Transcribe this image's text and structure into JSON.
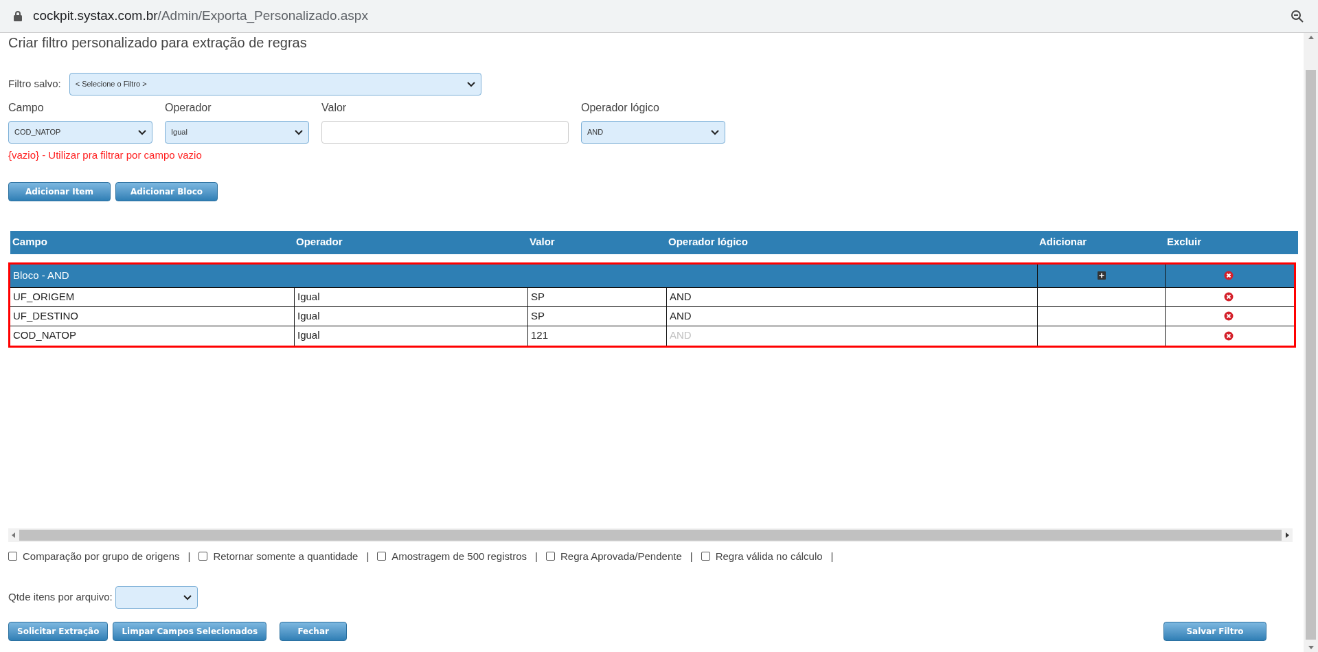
{
  "address_bar": {
    "host": "cockpit.systax.com.br",
    "path": "/Admin/Exporta_Personalizado.aspx"
  },
  "title": "Criar filtro personalizado para extração de regras",
  "saved_filter": {
    "label": "Filtro salvo:",
    "value": "< Selecione o Filtro >"
  },
  "fields": [
    {
      "label": "Campo",
      "kind": "select",
      "value": "COD_NATOP"
    },
    {
      "label": "Operador",
      "kind": "select",
      "value": "Igual"
    },
    {
      "label": "Valor",
      "kind": "input"
    },
    {
      "label": "Operador lógico",
      "kind": "select",
      "value": "AND"
    }
  ],
  "hint": "{vazio} - Utilizar pra filtrar por campo vazio",
  "add_buttons": [
    "Adicionar Item",
    "Adicionar Bloco"
  ],
  "table": {
    "columns": [
      "Campo",
      "Operador",
      "Valor",
      "Operador lógico",
      "Adicionar",
      "Excluir"
    ],
    "block": {
      "label": "Bloco - AND"
    },
    "rows": [
      {
        "campo": "UF_ORIGEM",
        "operador": "Igual",
        "valor": "SP",
        "operador_logico": "AND",
        "logic_disabled": false
      },
      {
        "campo": "UF_DESTINO",
        "operador": "Igual",
        "valor": "SP",
        "operador_logico": "AND",
        "logic_disabled": false
      },
      {
        "campo": "COD_NATOP",
        "operador": "Igual",
        "valor": "121",
        "operador_logico": "AND",
        "logic_disabled": true
      }
    ]
  },
  "options": [
    {
      "label": "Comparação por grupo de origens",
      "checked": false
    },
    {
      "label": "Retornar somente a quantidade",
      "checked": false
    },
    {
      "label": "Amostragem de 500 registros",
      "checked": false
    },
    {
      "label": "Regra Aprovada/Pendente",
      "checked": false
    },
    {
      "label": "Regra válida no cálculo",
      "checked": false
    }
  ],
  "separator": "|",
  "qtde": {
    "label": "Qtde itens por arquivo:"
  },
  "bottom_buttons": [
    "Solicitar Extração",
    "Limpar Campos Selecionados",
    "Fechar"
  ],
  "save_button": "Salvar Filtro"
}
